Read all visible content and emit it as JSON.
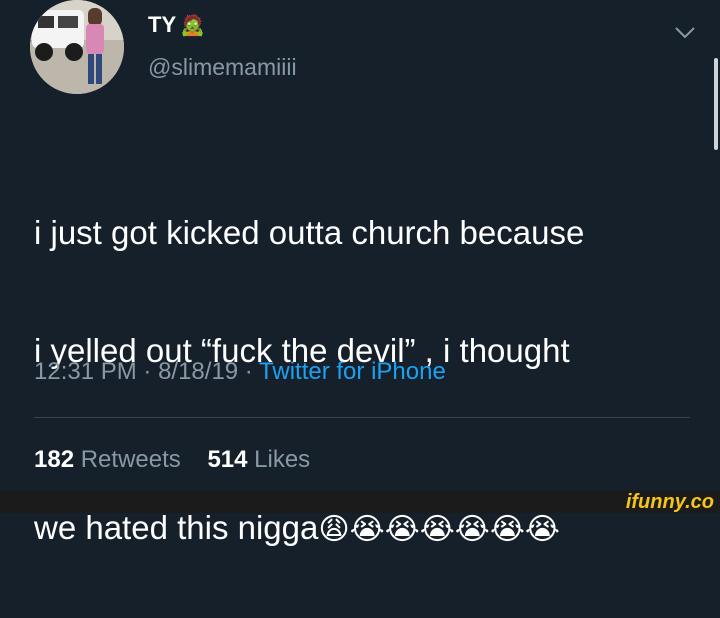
{
  "user": {
    "display_name": "TY",
    "name_emoji": "🧟",
    "handle": "@slimemamiiii"
  },
  "tweet": {
    "text_lines": [
      "i just got kicked outta church because",
      "i yelled out “fuck the devil” , i thought"
    ],
    "last_line_text": "we hated this nigga",
    "emojis": "😩😭😭😭😭😭😭",
    "time": "12:31 PM",
    "date": "8/18/19",
    "separator": " · ",
    "source": "Twitter for iPhone"
  },
  "stats": {
    "retweets_count": "182",
    "retweets_label": "Retweets",
    "likes_count": "514",
    "likes_label": "Likes"
  },
  "watermark": {
    "text": "ifunny.co"
  },
  "icons": {
    "chevron": "chevron-down-icon",
    "avatar": "avatar"
  },
  "colors": {
    "background": "#15202b",
    "secondary_text": "#8899a6",
    "link": "#1da1f2"
  }
}
